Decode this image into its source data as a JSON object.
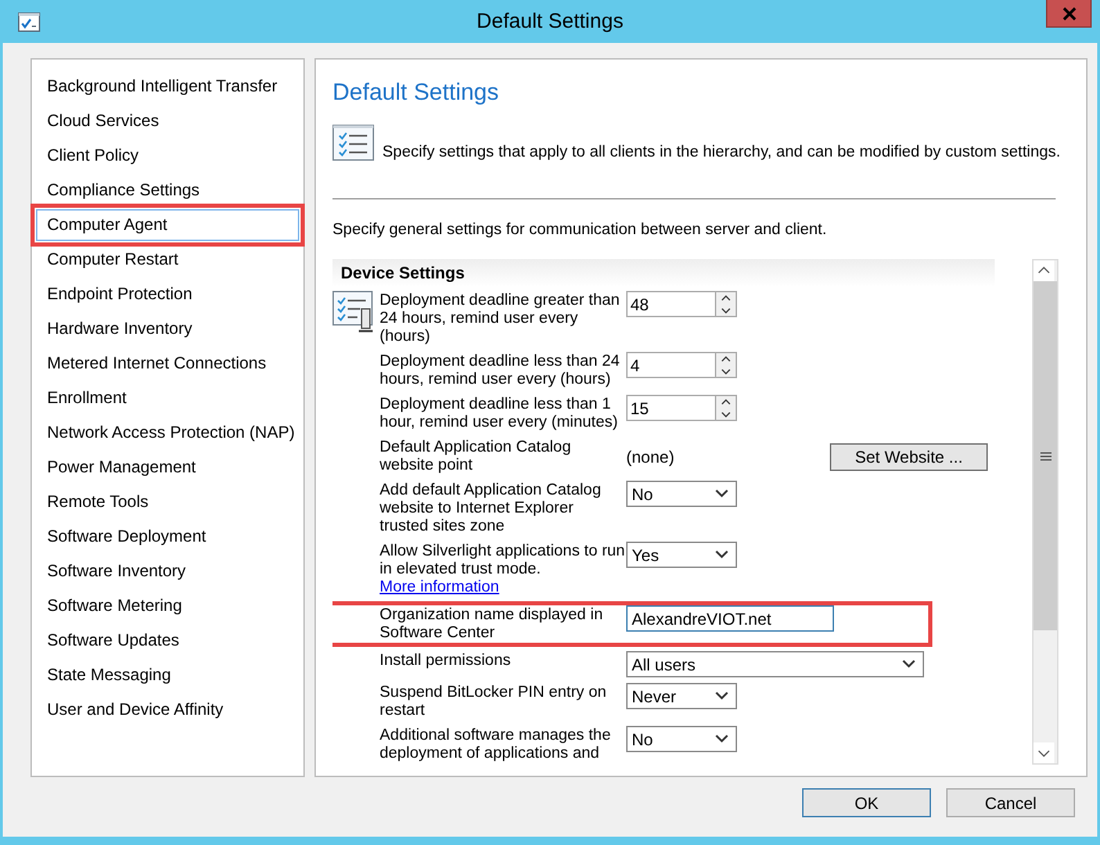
{
  "window": {
    "title": "Default Settings"
  },
  "sidebar": {
    "items": [
      {
        "label": "Background Intelligent Transfer",
        "selected": false,
        "highlighted": false
      },
      {
        "label": "Cloud Services",
        "selected": false,
        "highlighted": false
      },
      {
        "label": "Client Policy",
        "selected": false,
        "highlighted": false
      },
      {
        "label": "Compliance Settings",
        "selected": false,
        "highlighted": false
      },
      {
        "label": "Computer Agent",
        "selected": true,
        "highlighted": true
      },
      {
        "label": "Computer Restart",
        "selected": false,
        "highlighted": false
      },
      {
        "label": "Endpoint Protection",
        "selected": false,
        "highlighted": false
      },
      {
        "label": "Hardware Inventory",
        "selected": false,
        "highlighted": false
      },
      {
        "label": "Metered Internet Connections",
        "selected": false,
        "highlighted": false
      },
      {
        "label": "Enrollment",
        "selected": false,
        "highlighted": false
      },
      {
        "label": "Network Access Protection (NAP)",
        "selected": false,
        "highlighted": false
      },
      {
        "label": "Power Management",
        "selected": false,
        "highlighted": false
      },
      {
        "label": "Remote Tools",
        "selected": false,
        "highlighted": false
      },
      {
        "label": "Software Deployment",
        "selected": false,
        "highlighted": false
      },
      {
        "label": "Software Inventory",
        "selected": false,
        "highlighted": false
      },
      {
        "label": "Software Metering",
        "selected": false,
        "highlighted": false
      },
      {
        "label": "Software Updates",
        "selected": false,
        "highlighted": false
      },
      {
        "label": "State Messaging",
        "selected": false,
        "highlighted": false
      },
      {
        "label": "User and Device Affinity",
        "selected": false,
        "highlighted": false
      }
    ]
  },
  "page": {
    "title": "Default Settings",
    "description": "Specify settings that apply to all clients in the hierarchy, and can be modified by custom settings.",
    "intro": "Specify general settings for communication between server and client."
  },
  "device_settings": {
    "title": "Device Settings",
    "settings": [
      {
        "kind": "spinner",
        "label": "Deployment deadline greater than 24 hours, remind user every (hours)",
        "value": "48",
        "highlighted": false
      },
      {
        "kind": "spinner",
        "label": "Deployment deadline less than 24 hours, remind user every (hours)",
        "value": "4",
        "highlighted": false
      },
      {
        "kind": "spinner",
        "label": "Deployment deadline less than 1 hour, remind user every (minutes)",
        "value": "15",
        "highlighted": false
      },
      {
        "kind": "readonly",
        "label": "Default Application Catalog website point",
        "value": "(none)",
        "button": "Set Website ...",
        "highlighted": false
      },
      {
        "kind": "dropdown",
        "label": "Add default Application Catalog website to Internet Explorer trusted sites zone",
        "value": "No",
        "highlighted": false
      },
      {
        "kind": "dropdown",
        "label": "Allow Silverlight applications to run in elevated trust mode.",
        "link": "More information",
        "value": "Yes",
        "highlighted": false
      },
      {
        "kind": "textbox",
        "label": "Organization name displayed in Software Center",
        "value": "AlexandreVIOT.net",
        "highlighted": true
      },
      {
        "kind": "combobox",
        "label": "Install permissions",
        "value": "All users",
        "highlighted": false
      },
      {
        "kind": "dropdown",
        "label": "Suspend BitLocker PIN entry on restart",
        "value": "Never",
        "highlighted": false
      },
      {
        "kind": "dropdown",
        "label": "Additional software manages the deployment of applications and",
        "value": "No",
        "highlighted": false
      }
    ]
  },
  "buttons": [
    "OK",
    "Cancel"
  ]
}
